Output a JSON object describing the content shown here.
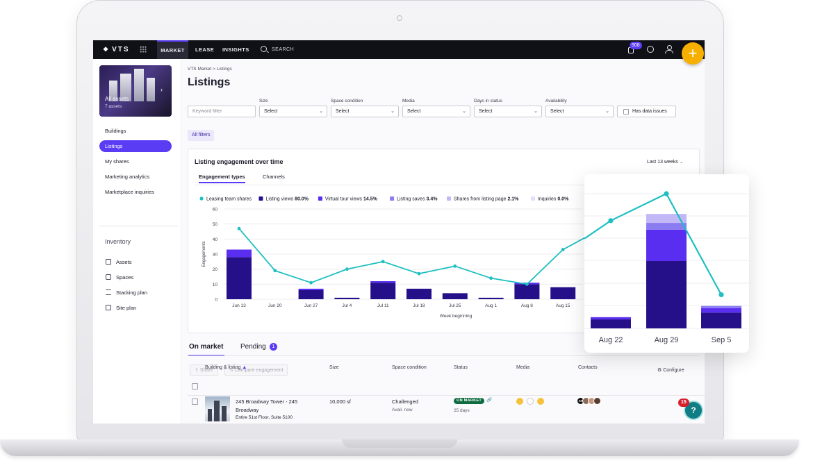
{
  "app": {
    "logo": "VTS"
  },
  "topnav": {
    "items": [
      {
        "label": "MARKET"
      },
      {
        "label": "LEASE"
      },
      {
        "label": "INSIGHTS"
      }
    ],
    "search_label": "SEARCH",
    "notification_count": "908",
    "accent": "#5b3cf5"
  },
  "sidebar": {
    "asset_card": {
      "title": "All assets",
      "subtitle": "7 assets"
    },
    "items": [
      {
        "label": "Buildings"
      },
      {
        "label": "Listings"
      },
      {
        "label": "My shares"
      },
      {
        "label": "Marketing analytics"
      },
      {
        "label": "Marketplace inquiries"
      }
    ],
    "section_title": "Inventory",
    "inventory": [
      {
        "label": "Assets",
        "icon": "building-icon"
      },
      {
        "label": "Spaces",
        "icon": "spaces-icon"
      },
      {
        "label": "Stacking plan",
        "icon": "stack-icon"
      },
      {
        "label": "Site plan",
        "icon": "site-plan-icon"
      }
    ]
  },
  "main": {
    "breadcrumb": {
      "root": "VTS Market",
      "sep": ">",
      "current": "Listings"
    },
    "title": "Listings",
    "filters": {
      "keyword_placeholder": "Keyword filter",
      "selects": [
        {
          "label": "Size",
          "value": "Select"
        },
        {
          "label": "Space condition",
          "value": "Select"
        },
        {
          "label": "Media",
          "value": "Select"
        },
        {
          "label": "Days in status",
          "value": "Select"
        },
        {
          "label": "Availability",
          "value": "Select"
        }
      ],
      "has_data_issues": "Has data issues",
      "all_filters": "All filters"
    },
    "chart_card": {
      "title": "Listing engagement over time",
      "period": "Last 13 weeks",
      "tabs": [
        {
          "label": "Engagement types"
        },
        {
          "label": "Channels"
        }
      ]
    },
    "lower_tabs": [
      {
        "label": "On market"
      },
      {
        "label": "Pending"
      }
    ],
    "pending_count": "1",
    "toolbar": {
      "share": "Share",
      "compare": "Compare engagement",
      "configure": "Configure"
    },
    "table": {
      "headers": [
        "Building & listing",
        "Size",
        "Space condition",
        "Status",
        "Media",
        "Contacts"
      ],
      "rows": [
        {
          "building": "245 Broadway Tower - 245",
          "building2": "Broadway",
          "suite": "Entire 51st Floor, Suite 5100",
          "size": "10,000 sf",
          "condition": "Challenged",
          "condition_sub": "Avail. now",
          "status": "ON MARKET",
          "status_sub": "25 days",
          "contact_initials": "AY"
        }
      ]
    },
    "help_badge": "15",
    "help_label": "?"
  },
  "chart_data": [
    {
      "type": "bar",
      "title": "",
      "xlabel": "Week beginning",
      "ylabel": "Engagements",
      "ylim": [
        0,
        60
      ],
      "yticks": [
        0,
        10,
        20,
        30,
        40,
        50,
        60
      ],
      "grid": true,
      "legend_position": "top",
      "categories": [
        "Jun 13",
        "Jun 20",
        "Jun 27",
        "Jul 4",
        "Jul 11",
        "Jul 18",
        "Jul 25",
        "Aug 1",
        "Aug 8",
        "Aug 15",
        "Aug 22",
        "Aug 29",
        "Sep 5"
      ],
      "series": [
        {
          "name": "Leasing team shares",
          "kind": "line",
          "color": "#1dbfc1",
          "values": [
            47,
            19,
            11,
            20,
            25,
            17,
            22,
            14,
            10,
            33,
            48,
            60,
            15
          ]
        },
        {
          "name": "Listing views",
          "pct": "80.0%",
          "kind": "bar",
          "color": "#26108a",
          "values": [
            28,
            0,
            6,
            1,
            11,
            7,
            4,
            1,
            10,
            8,
            4,
            30,
            7
          ]
        },
        {
          "name": "Virtual tour views",
          "pct": "14.5%",
          "kind": "bar",
          "color": "#5a2ef0",
          "values": [
            5,
            0,
            1,
            0,
            1,
            0,
            0,
            0,
            1,
            0,
            1,
            14,
            2
          ]
        },
        {
          "name": "Listing saves",
          "pct": "3.4%",
          "kind": "bar",
          "color": "#8c7cf2",
          "values": [
            0,
            0,
            0,
            0,
            0,
            0,
            0,
            0,
            0,
            0,
            0,
            3,
            1
          ]
        },
        {
          "name": "Shares from listing page",
          "pct": "2.1%",
          "kind": "bar",
          "color": "#c2b8f7",
          "values": [
            0,
            0,
            0,
            0,
            0,
            0,
            0,
            0,
            0,
            0,
            0,
            4,
            0
          ]
        },
        {
          "name": "Inquiries",
          "pct": "0.0%",
          "kind": "bar",
          "color": "#e3defb",
          "values": [
            0,
            0,
            0,
            0,
            0,
            0,
            0,
            0,
            0,
            0,
            0,
            0,
            0
          ]
        }
      ]
    },
    {
      "type": "bar",
      "title": "",
      "categories": [
        "Aug 22",
        "Aug 29",
        "Sep 5"
      ],
      "ylim": [
        0,
        60
      ],
      "series": [
        {
          "name": "Leasing team shares",
          "kind": "line",
          "color": "#1dbfc1",
          "values": [
            48,
            60,
            15
          ]
        },
        {
          "name": "Listing views",
          "kind": "bar",
          "color": "#26108a",
          "values": [
            4,
            30,
            7
          ]
        },
        {
          "name": "Virtual tour views",
          "kind": "bar",
          "color": "#5a2ef0",
          "values": [
            1,
            14,
            2
          ]
        },
        {
          "name": "Listing saves",
          "kind": "bar",
          "color": "#8c7cf2",
          "values": [
            0,
            3,
            1
          ]
        },
        {
          "name": "Shares from listing page",
          "kind": "bar",
          "color": "#c2b8f7",
          "values": [
            0,
            4,
            0
          ]
        }
      ]
    }
  ]
}
